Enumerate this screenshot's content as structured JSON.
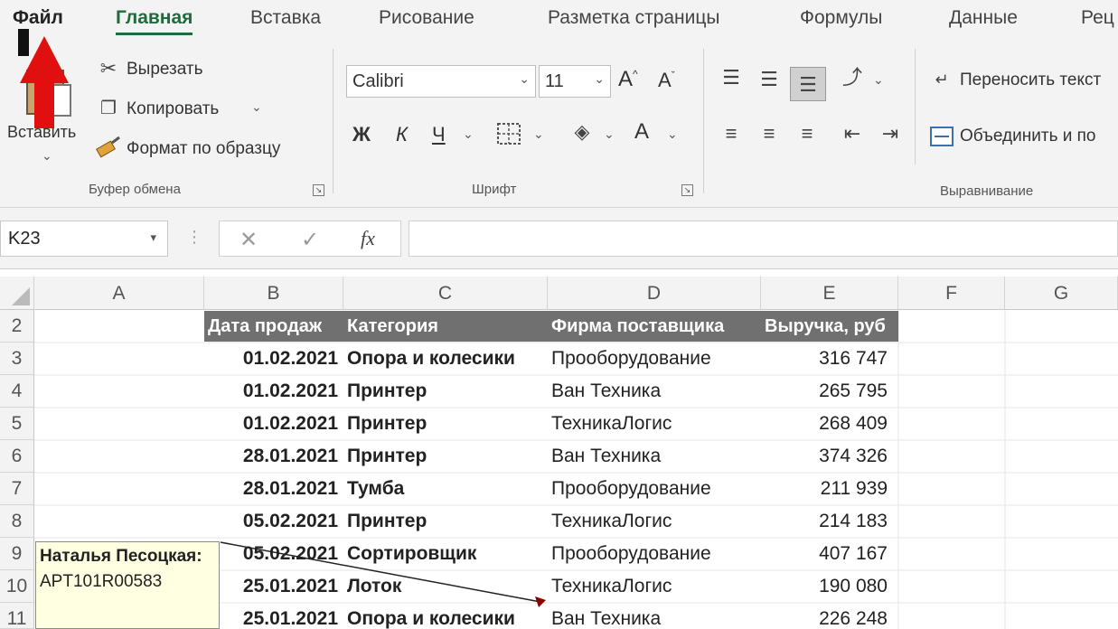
{
  "tabs": [
    "Файл",
    "Главная",
    "Вставка",
    "Рисование",
    "Разметка страницы",
    "Формулы",
    "Данные",
    "Рец"
  ],
  "ribbon": {
    "clipboard": {
      "paste": "Вставить",
      "cut": "Вырезать",
      "copy": "Копировать",
      "format_painter": "Формат по образцу",
      "group": "Буфер обмена"
    },
    "font": {
      "name": "Calibri",
      "size": "11",
      "bold": "Ж",
      "italic": "К",
      "underline": "Ч",
      "font_color_letter": "A",
      "grow": "A",
      "shrink": "A",
      "group": "Шрифт"
    },
    "alignment": {
      "wrap": "Переносить текст",
      "merge": "Объединить и по",
      "group": "Выравнивание"
    }
  },
  "formula_bar": {
    "name_box": "K23",
    "fx": "fx",
    "formula": ""
  },
  "columns": [
    "A",
    "B",
    "C",
    "D",
    "E",
    "F",
    "G"
  ],
  "rows": [
    "2",
    "3",
    "4",
    "5",
    "6",
    "7",
    "8",
    "9",
    "10",
    "11"
  ],
  "table": {
    "headers": [
      "Дата продаж",
      "Категория",
      "Фирма поставщика",
      "Выручка, руб"
    ],
    "rows": [
      [
        "01.02.2021",
        "Опора и колесики",
        "Прооборудование",
        "316 747"
      ],
      [
        "01.02.2021",
        "Принтер",
        "Ван Техника",
        "265 795"
      ],
      [
        "01.02.2021",
        "Принтер",
        "ТехникаЛогис",
        "268 409"
      ],
      [
        "28.01.2021",
        "Принтер",
        "Ван Техника",
        "374 326"
      ],
      [
        "28.01.2021",
        "Тумба",
        "Прооборудование",
        "211 939"
      ],
      [
        "05.02.2021",
        "Принтер",
        "ТехникаЛогис",
        "214 183"
      ],
      [
        "05.02.2021",
        "Сортировщик",
        "Прооборудование",
        "407 167"
      ],
      [
        "25.01.2021",
        "Лоток",
        "ТехникаЛогис",
        "190 080"
      ],
      [
        "25.01.2021",
        "Опора и колесики",
        "Ван Техника",
        "226 248"
      ]
    ]
  },
  "comment": {
    "author": "Наталья Песоцкая:",
    "text": "APT101R00583"
  },
  "colors": {
    "accent": "#1e6b3c",
    "header_fill": "#707070",
    "arrow": "#e01010",
    "comment_fill": "#ffffe1"
  }
}
